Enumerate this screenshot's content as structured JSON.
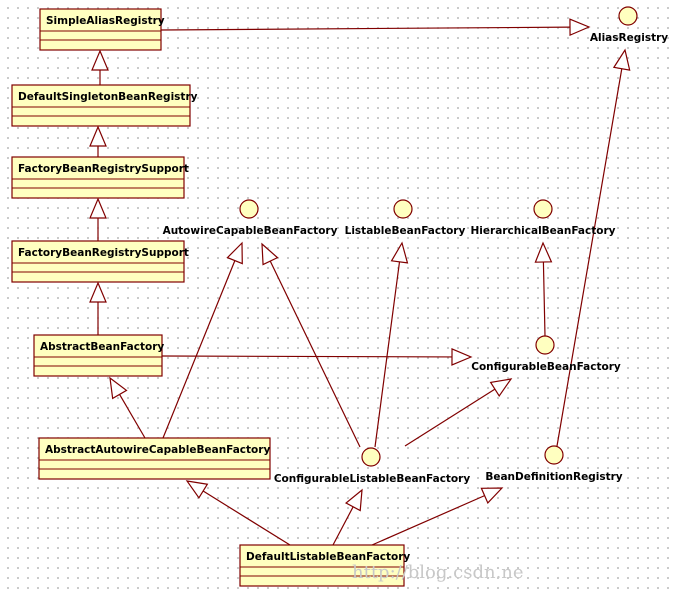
{
  "colors": {
    "line": "#800000",
    "fill": "#ffffc0",
    "text": "#000000"
  },
  "classes": [
    {
      "id": "sar",
      "name": "SimpleAliasRegistry"
    },
    {
      "id": "dsbr",
      "name": "DefaultSingletonBeanRegistry"
    },
    {
      "id": "fbrs1",
      "name": "FactoryBeanRegistrySupport"
    },
    {
      "id": "fbrs2",
      "name": "FactoryBeanRegistrySupport"
    },
    {
      "id": "abf",
      "name": "AbstractBeanFactory"
    },
    {
      "id": "aacbf",
      "name": "AbstractAutowireCapableBeanFactory"
    },
    {
      "id": "dlbf",
      "name": "DefaultListableBeanFactory"
    }
  ],
  "interfaces": [
    {
      "id": "ar",
      "name": "AliasRegistry"
    },
    {
      "id": "acbf",
      "name": "AutowireCapableBeanFactory"
    },
    {
      "id": "lbf",
      "name": "ListableBeanFactory"
    },
    {
      "id": "hbf",
      "name": "HierarchicalBeanFactory"
    },
    {
      "id": "cbf",
      "name": "ConfigurableBeanFactory"
    },
    {
      "id": "clbf",
      "name": "ConfigurableListableBeanFactory"
    },
    {
      "id": "bdr",
      "name": "BeanDefinitionRegistry"
    }
  ],
  "relations": [
    {
      "from": "sar",
      "to": "ar"
    },
    {
      "from": "dsbr",
      "to": "sar"
    },
    {
      "from": "fbrs1",
      "to": "dsbr"
    },
    {
      "from": "fbrs2",
      "to": "fbrs1"
    },
    {
      "from": "abf",
      "to": "fbrs2"
    },
    {
      "from": "abf",
      "to": "cbf"
    },
    {
      "from": "aacbf",
      "to": "abf"
    },
    {
      "from": "aacbf",
      "to": "acbf"
    },
    {
      "from": "clbf",
      "to": "acbf"
    },
    {
      "from": "clbf",
      "to": "lbf"
    },
    {
      "from": "clbf",
      "to": "cbf"
    },
    {
      "from": "cbf",
      "to": "hbf"
    },
    {
      "from": "bdr",
      "to": "ar"
    },
    {
      "from": "dlbf",
      "to": "aacbf"
    },
    {
      "from": "dlbf",
      "to": "clbf"
    },
    {
      "from": "dlbf",
      "to": "bdr"
    }
  ],
  "watermark": "http://blog.csdn.ne"
}
